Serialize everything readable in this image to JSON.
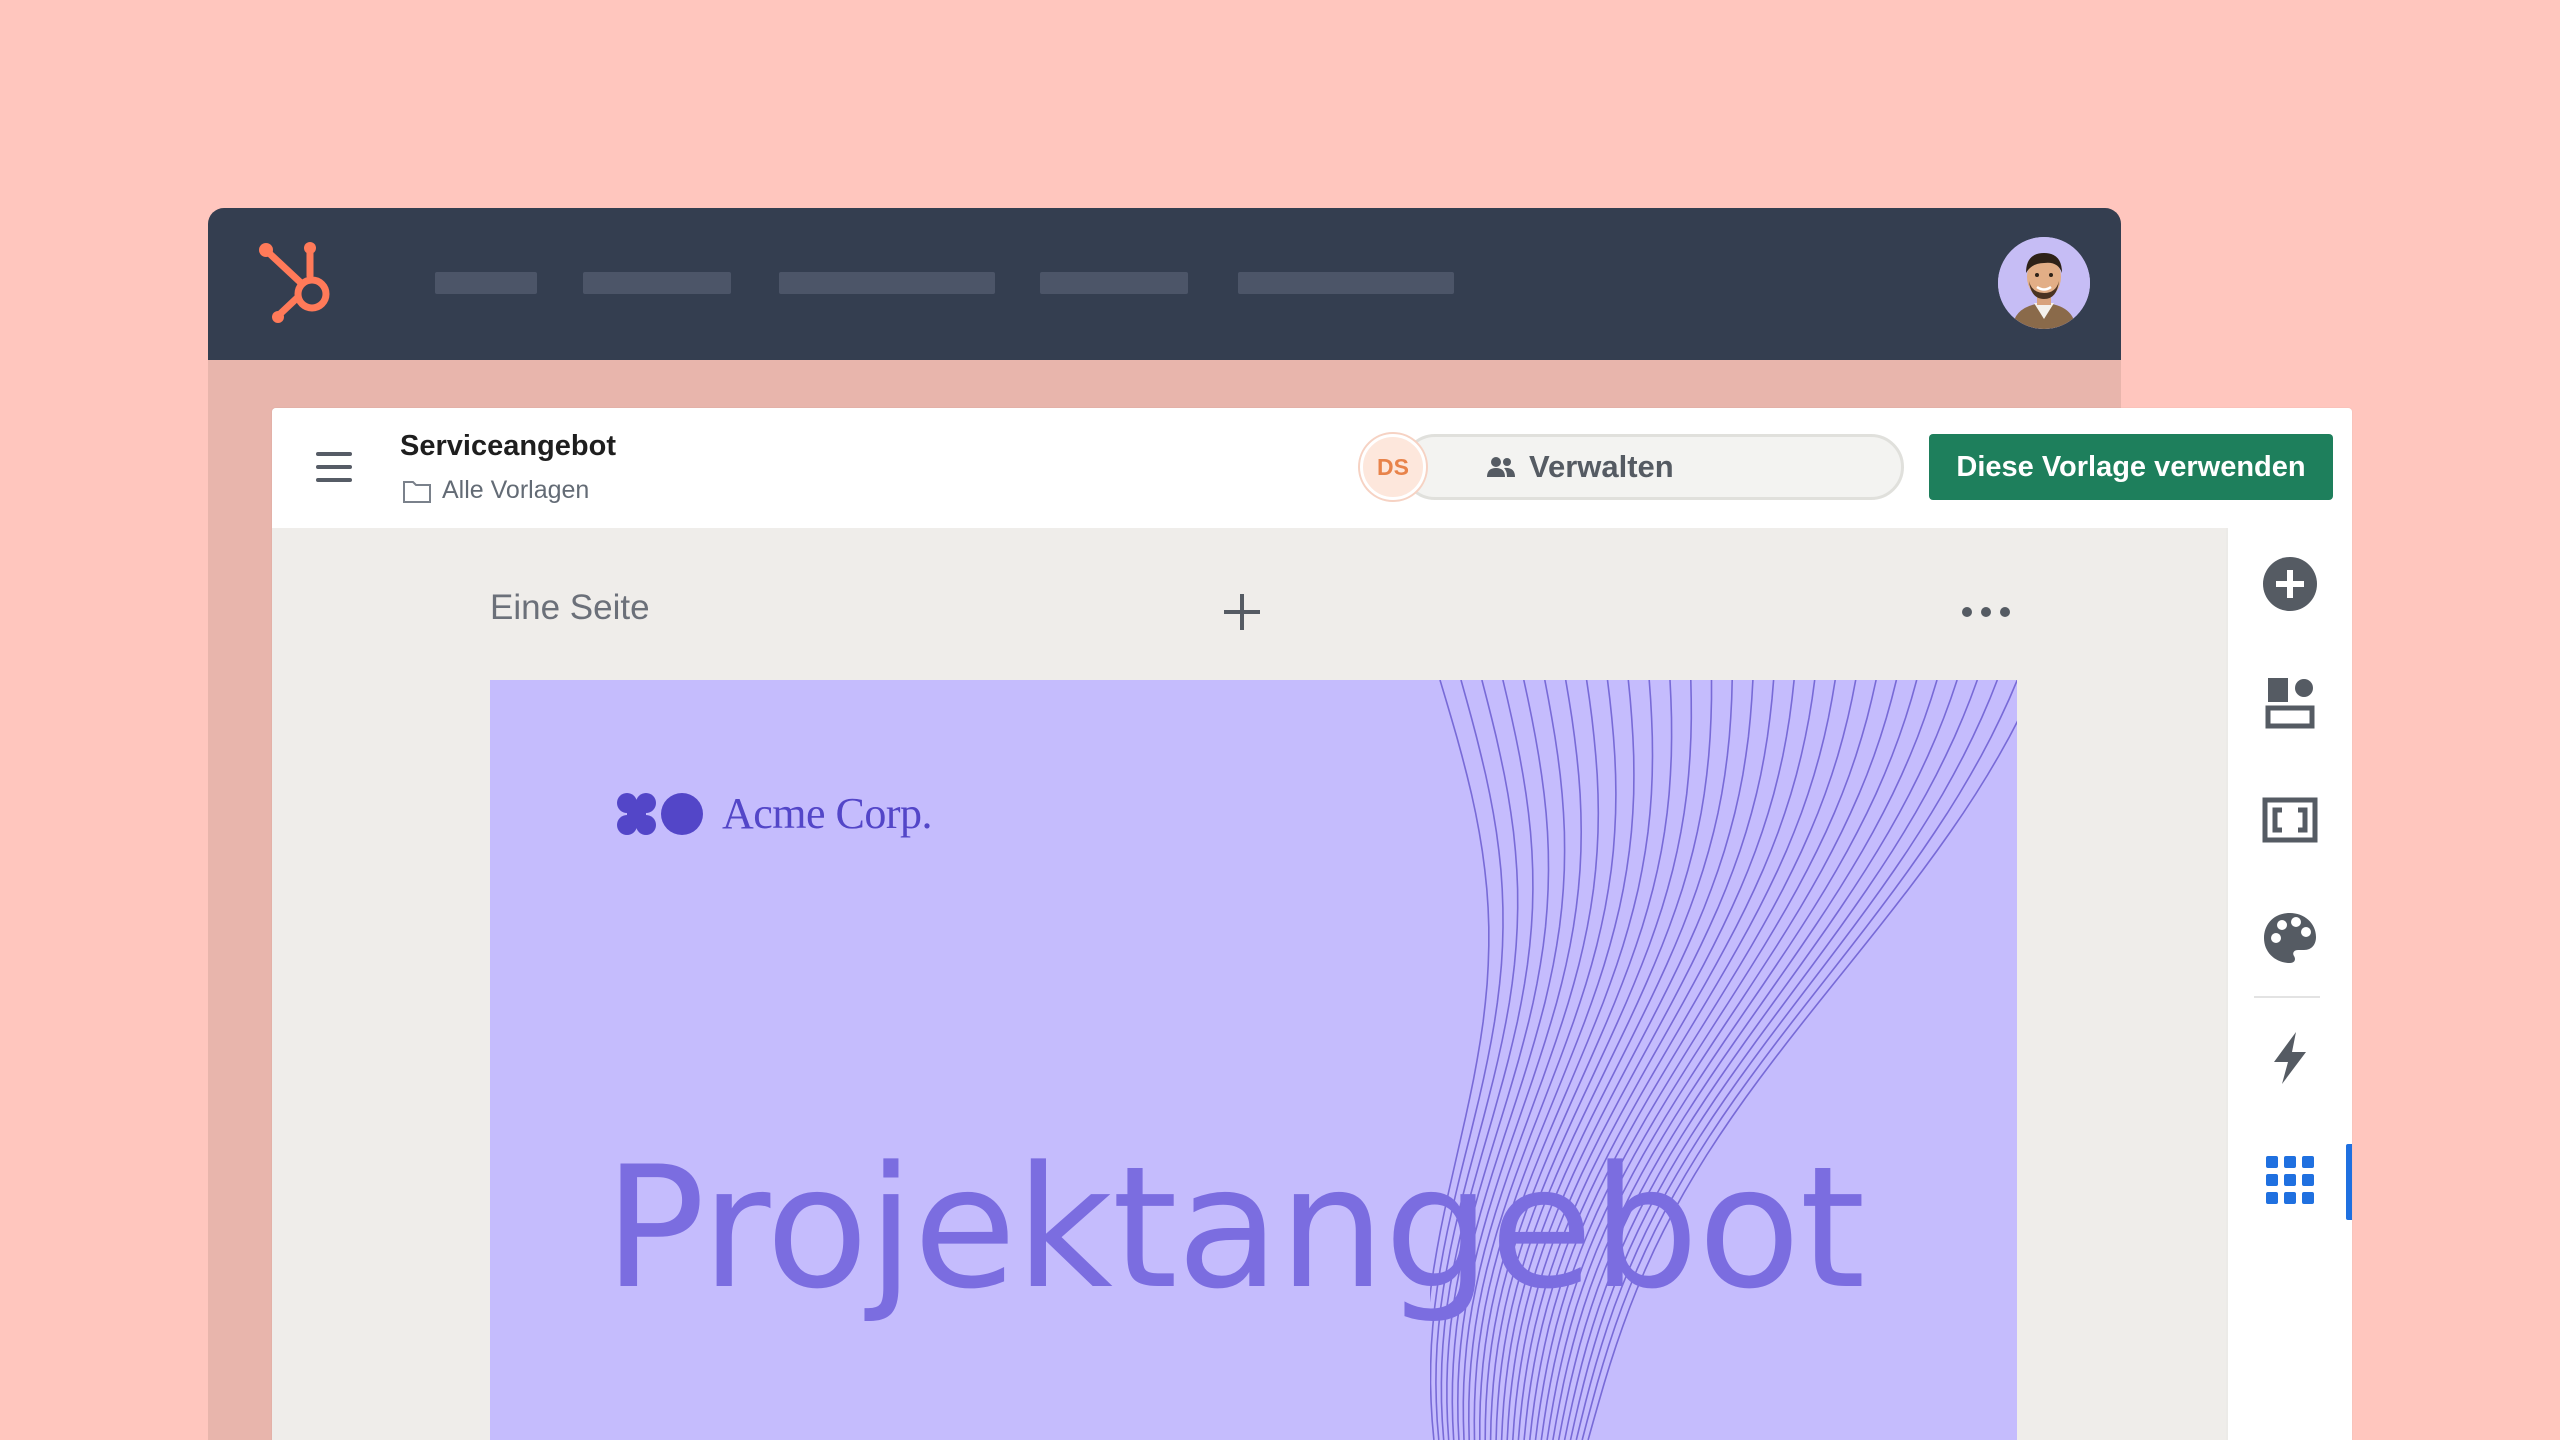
{
  "editor": {
    "title": "Serviceangebot",
    "breadcrumb": "Alle Vorlagen",
    "collaborator_initials": "DS",
    "manage_label": "Verwalten",
    "use_template_label": "Diese Vorlage verwenden",
    "help_label": "?"
  },
  "canvas": {
    "page_label": "Eine Seite"
  },
  "slide": {
    "brand": "Acme Corp.",
    "title": "Projektangebot"
  },
  "colors": {
    "background": "#ffc6be",
    "topnav": "#343e50",
    "brand_orange": "#ff7a59",
    "primary_green": "#1e7f5c",
    "slide_bg": "#c5bcfd",
    "slide_accent": "#5346c8",
    "active_blue": "#1f70e0"
  },
  "sidebar_icons": [
    "add-icon",
    "layout-icon",
    "frame-icon",
    "palette-icon",
    "lightning-icon",
    "apps-grid-icon"
  ]
}
